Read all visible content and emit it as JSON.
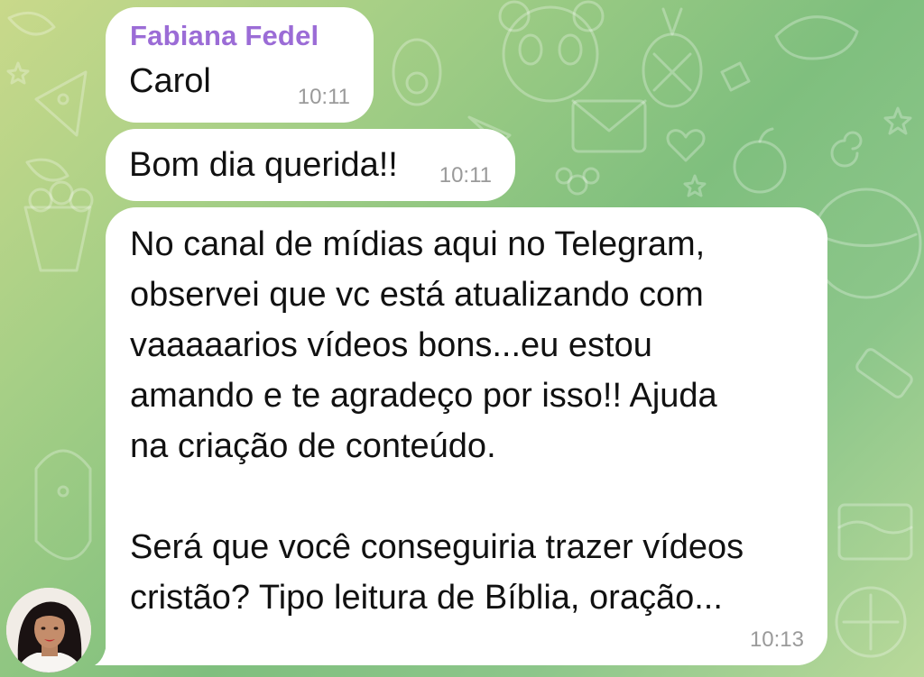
{
  "chat": {
    "sender_name": "Fabiana Fedel",
    "messages": [
      {
        "text": "Carol",
        "time": "10:11"
      },
      {
        "text": "Bom dia querida!!",
        "time": "10:11"
      },
      {
        "lines": [
          "No canal de mídias aqui no Telegram,",
          "observei que vc está atualizando com",
          "vaaaaarios vídeos bons...eu estou",
          "amando e te agradeço por isso!! Ajuda",
          "na criação de conteúdo.",
          "",
          "Será que você conseguiria trazer vídeos",
          "cristão? Tipo leitura de Bíblia, oração..."
        ],
        "time": "10:13"
      }
    ]
  },
  "colors": {
    "sender_name": "#9b6cd6",
    "bubble": "#ffffff",
    "timestamp": "#9a9a9a"
  },
  "icons": [
    "avatar-photo",
    "wallpaper-doodles"
  ]
}
